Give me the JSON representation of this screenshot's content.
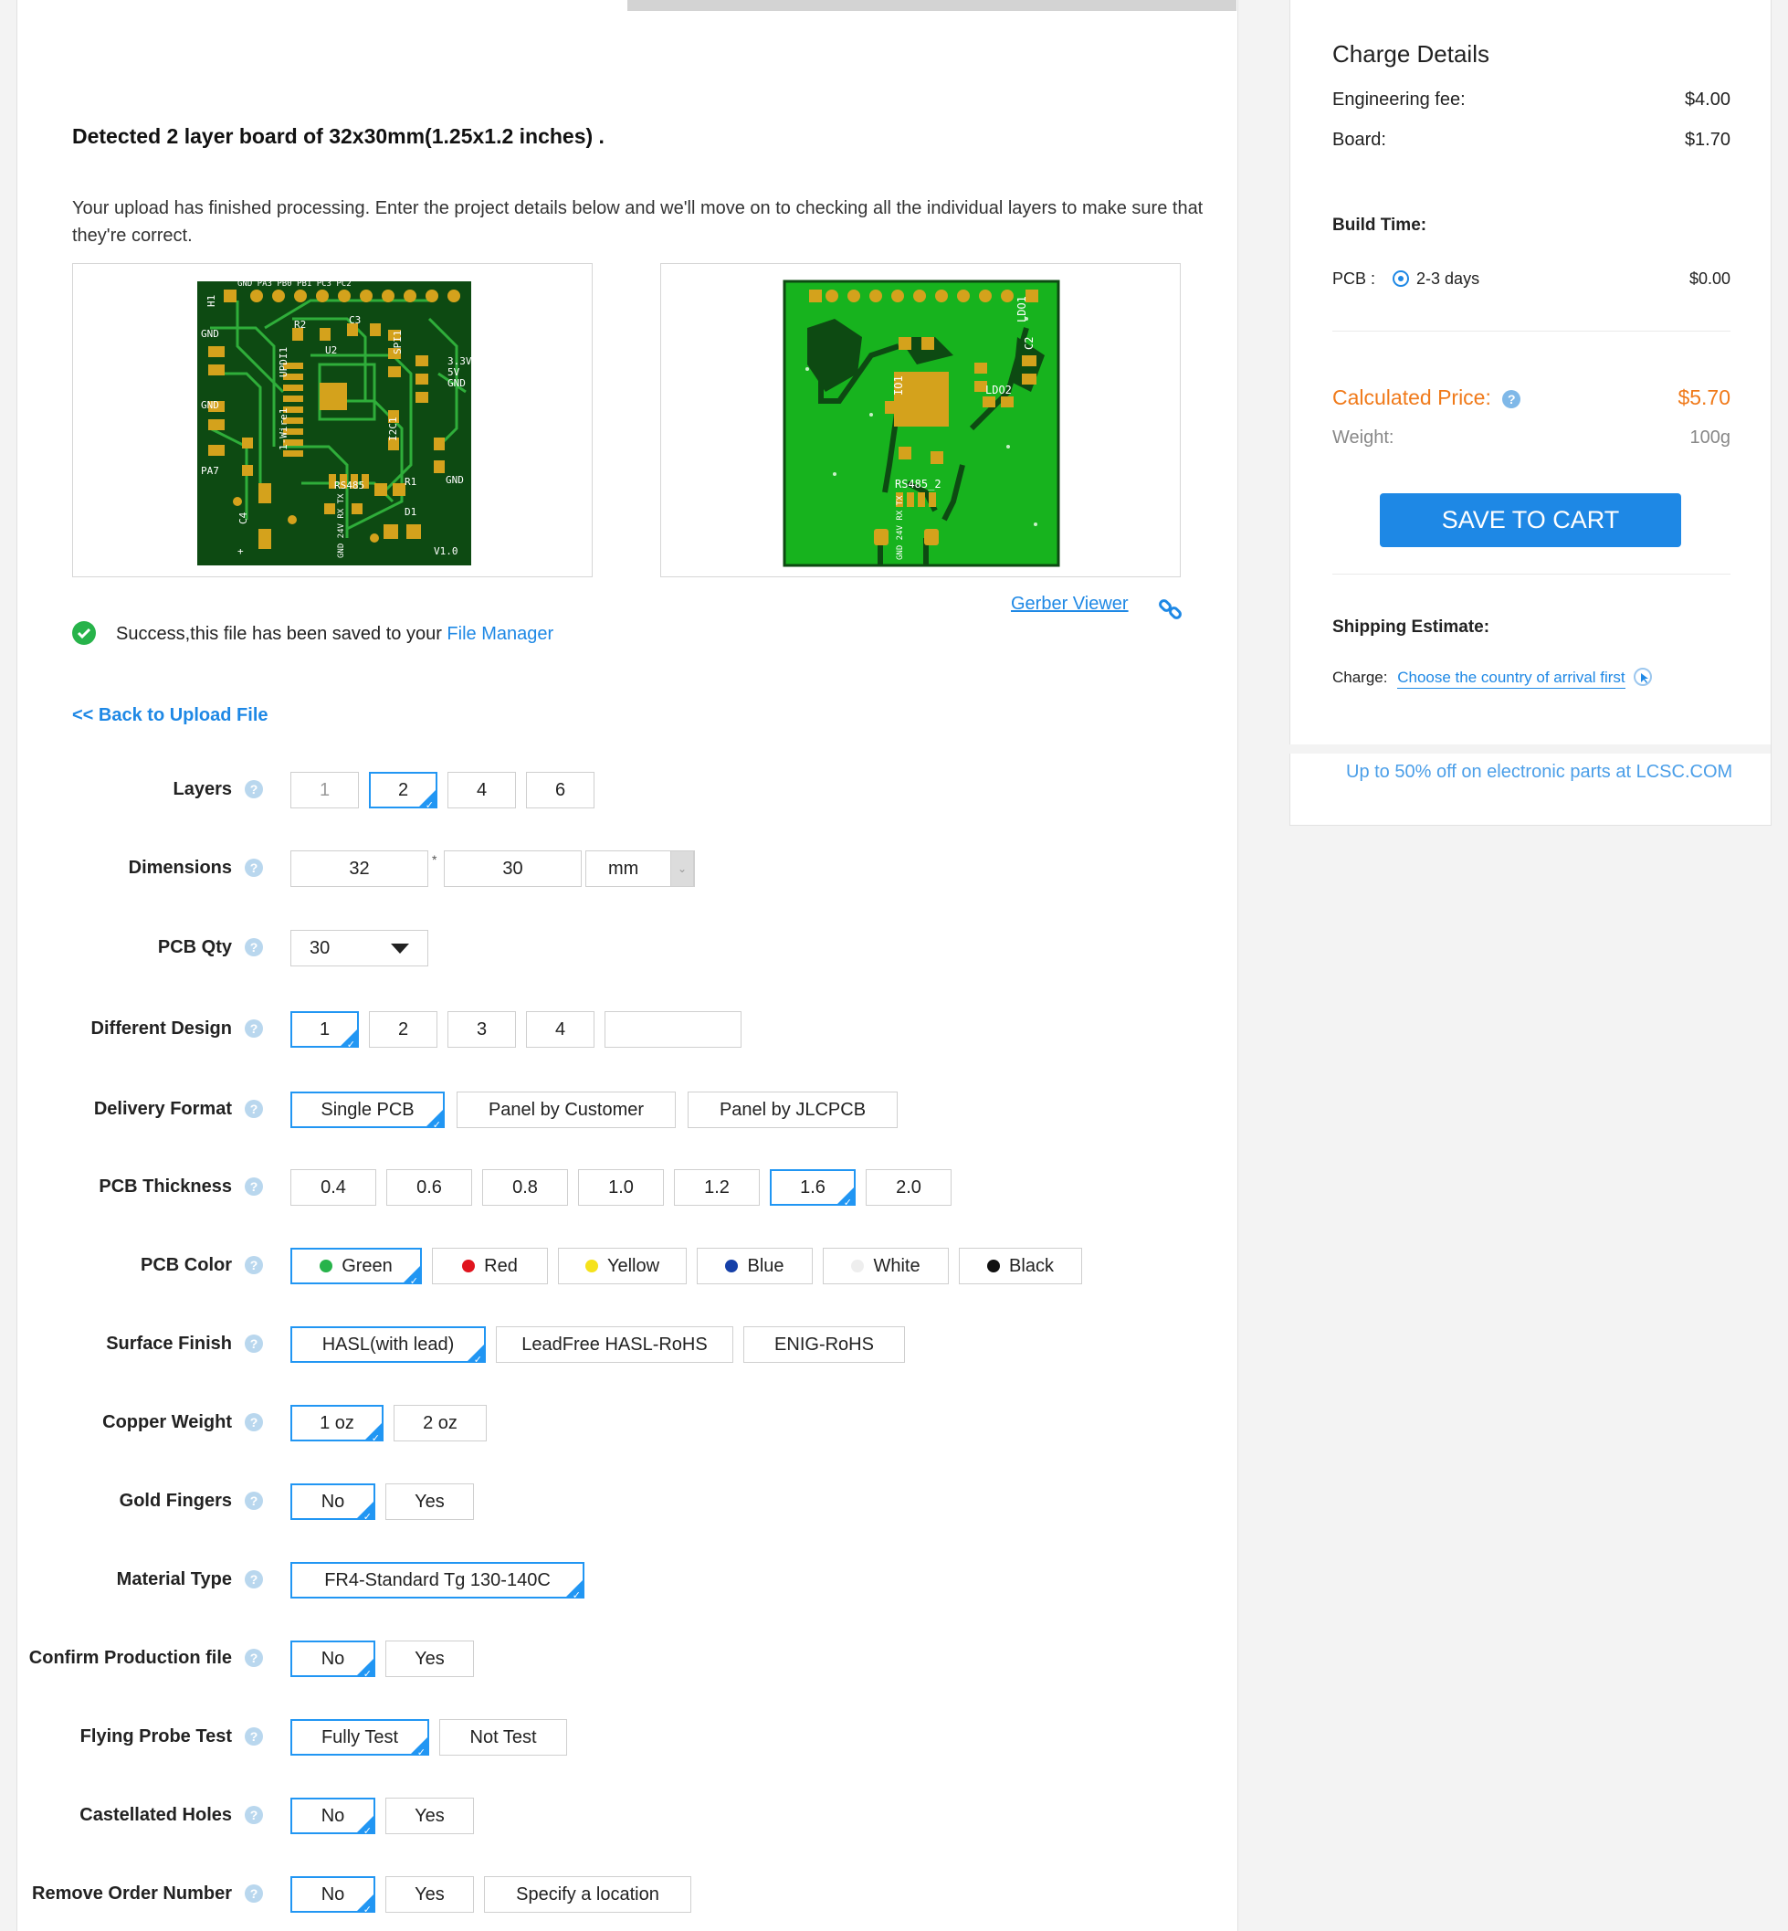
{
  "header": {
    "detected": "Detected 2 layer board of 32x30mm(1.25x1.2 inches) .",
    "description": "Your upload has finished processing. Enter the project details below and we'll move on to checking all the individual layers to make sure that they're correct."
  },
  "pcb_top": {
    "labels": [
      "H1",
      "GND",
      "UPDI1",
      "GND",
      "1-Wire1",
      "PA7",
      "C4",
      "R2",
      "C3",
      "U2",
      "SPI1",
      "3.3V",
      "5V",
      "GND",
      "I2C1",
      "R1",
      "GND",
      "RS485",
      "D1",
      "V1.0",
      "GND",
      "24V",
      "RX",
      "TX",
      "GND",
      "PA6",
      "PA5",
      "PA4",
      "PA3",
      "PB0",
      "PB1",
      "PC3",
      "PC2",
      "+"
    ],
    "colors": {
      "board": "#0d4a12",
      "trace": "#2fae3a",
      "pad": "#d4a21c",
      "silk": "#ffffff"
    }
  },
  "pcb_bottom": {
    "labels": [
      "IO1",
      "LDO1",
      "LDO2",
      "C2",
      "RS485_2",
      "GND",
      "24V",
      "RX",
      "TX"
    ],
    "colors": {
      "board": "#17b31e",
      "outline": "#0d4a12",
      "pad": "#d4a21c"
    }
  },
  "gerber_viewer": "Gerber Viewer",
  "success": {
    "text": "Success,this file has been saved to your ",
    "link": "File Manager"
  },
  "back_link": "<< Back to Upload File",
  "options": {
    "layers": {
      "label": "Layers",
      "values": [
        "1",
        "2",
        "4",
        "6"
      ],
      "selected": "2"
    },
    "dimensions": {
      "label": "Dimensions",
      "width": "32",
      "height": "30",
      "unit": "mm",
      "separator": "*"
    },
    "pcb_qty": {
      "label": "PCB Qty",
      "value": "30"
    },
    "different_design": {
      "label": "Different Design",
      "values": [
        "1",
        "2",
        "3",
        "4"
      ],
      "selected": "1",
      "custom": ""
    },
    "delivery_format": {
      "label": "Delivery Format",
      "values": [
        "Single PCB",
        "Panel by Customer",
        "Panel by JLCPCB"
      ],
      "selected": "Single PCB"
    },
    "pcb_thickness": {
      "label": "PCB Thickness",
      "values": [
        "0.4",
        "0.6",
        "0.8",
        "1.0",
        "1.2",
        "1.6",
        "2.0"
      ],
      "selected": "1.6"
    },
    "pcb_color": {
      "label": "PCB Color",
      "values": [
        "Green",
        "Red",
        "Yellow",
        "Blue",
        "White",
        "Black"
      ],
      "dots": [
        "#27b34a",
        "#e0141e",
        "#f5e21b",
        "#1640a8",
        "#eeeeee",
        "#111111"
      ],
      "selected": "Green"
    },
    "surface_finish": {
      "label": "Surface Finish",
      "values": [
        "HASL(with lead)",
        "LeadFree HASL-RoHS",
        "ENIG-RoHS"
      ],
      "selected": "HASL(with lead)"
    },
    "copper_weight": {
      "label": "Copper Weight",
      "values": [
        "1 oz",
        "2 oz"
      ],
      "selected": "1 oz"
    },
    "gold_fingers": {
      "label": "Gold Fingers",
      "values": [
        "No",
        "Yes"
      ],
      "selected": "No"
    },
    "material_type": {
      "label": "Material Type",
      "values": [
        "FR4-Standard Tg 130-140C"
      ],
      "selected": "FR4-Standard Tg 130-140C"
    },
    "confirm_production": {
      "label": "Confirm Production file",
      "values": [
        "No",
        "Yes"
      ],
      "selected": "No"
    },
    "flying_probe": {
      "label": "Flying Probe Test",
      "values": [
        "Fully Test",
        "Not Test"
      ],
      "selected": "Fully Test"
    },
    "castellated": {
      "label": "Castellated Holes",
      "values": [
        "No",
        "Yes"
      ],
      "selected": "No"
    },
    "remove_order_number": {
      "label": "Remove Order Number",
      "values": [
        "No",
        "Yes",
        "Specify a location"
      ],
      "selected": "No"
    }
  },
  "charge": {
    "title": "Charge Details",
    "engineering_label": "Engineering fee:",
    "engineering_value": "$4.00",
    "board_label": "Board:",
    "board_value": "$1.70",
    "build_time_label": "Build Time:",
    "pcb_label": "PCB :",
    "pcb_option": "2-3 days",
    "pcb_value": "$0.00",
    "calculated_label": "Calculated Price:",
    "calculated_value": "$5.70",
    "weight_label": "Weight:",
    "weight_value": "100g",
    "save_button": "SAVE TO CART",
    "shipping_label": "Shipping Estimate:",
    "charge_label": "Charge:",
    "charge_link": "Choose the country of arrival first",
    "lcsc": "Up to 50% off on electronic parts at LCSC.COM",
    "accent": "#1e88e5",
    "price_color": "#f07a1a"
  }
}
